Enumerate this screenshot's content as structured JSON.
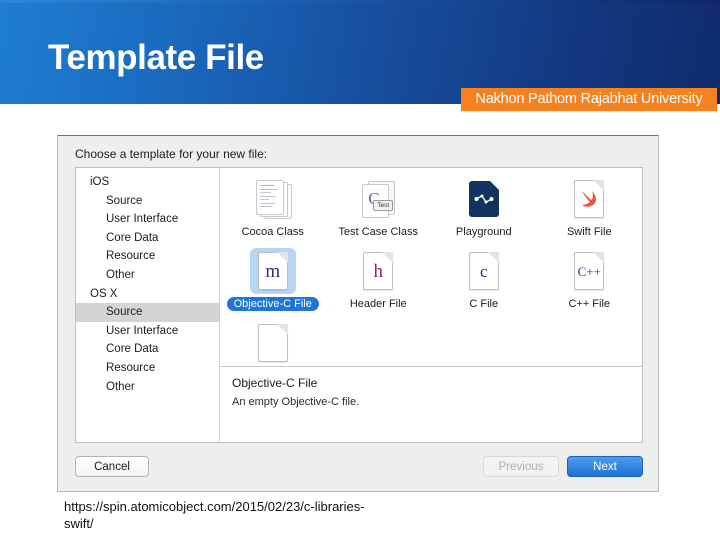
{
  "slide": {
    "title": "Template File",
    "university_badge": "Nakhon Pathom Rajabhat University",
    "source_url": "https://spin.atomicobject.com/2015/02/23/c-libraries-swift/",
    "colors": {
      "banner_left": "#1f7ed0",
      "banner_right": "#102a6b",
      "badge_orange": "#f5821f",
      "selection_blue": "#2075d8",
      "selection_tile_bg": "#b8d6f3"
    }
  },
  "dialog": {
    "prompt": "Choose a template for your new file:",
    "sidebar": {
      "groups": [
        {
          "label": "iOS",
          "items": [
            "Source",
            "User Interface",
            "Core Data",
            "Resource",
            "Other"
          ]
        },
        {
          "label": "OS X",
          "items": [
            "Source",
            "User Interface",
            "Core Data",
            "Resource",
            "Other"
          ]
        }
      ],
      "selected": "OS X / Source"
    },
    "templates": {
      "row1": [
        {
          "label": "Cocoa Class",
          "icon": "stacked-documents-icon",
          "selected": false
        },
        {
          "label": "Test Case Class",
          "icon": "test-case-document-icon",
          "selected": false
        },
        {
          "label": "Playground",
          "icon": "playground-icon",
          "selected": false
        },
        {
          "label": "Swift File",
          "icon": "swift-bird-icon",
          "selected": false
        }
      ],
      "row2": [
        {
          "label": "Objective-C File",
          "icon": "objective-c-m-file-icon",
          "selected": true
        },
        {
          "label": "Header File",
          "icon": "header-h-file-icon",
          "selected": false
        },
        {
          "label": "C File",
          "icon": "c-file-icon",
          "selected": false
        },
        {
          "label": "C++ File",
          "icon": "cpp-file-icon",
          "selected": false
        }
      ]
    },
    "description": {
      "title": "Objective-C File",
      "body": "An empty Objective-C file."
    },
    "footer": {
      "cancel": "Cancel",
      "previous": "Previous",
      "next": "Next"
    }
  }
}
